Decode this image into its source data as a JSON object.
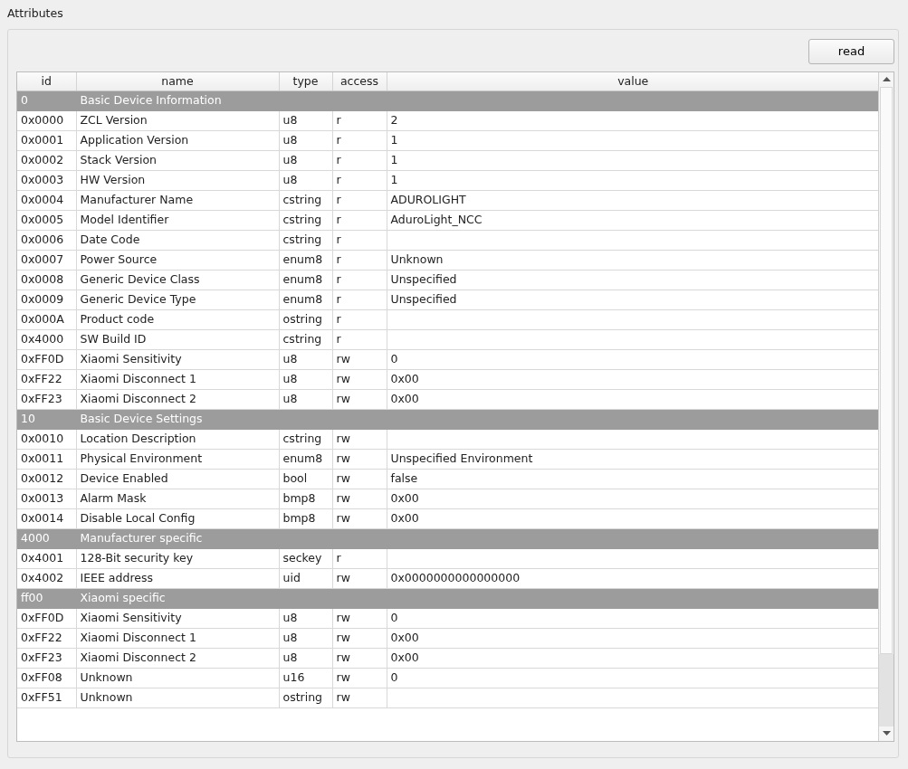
{
  "group_title": "Attributes",
  "read_button": "read",
  "table": {
    "columns": [
      "id",
      "name",
      "type",
      "access",
      "value"
    ],
    "rows": [
      {
        "kind": "group",
        "id": "0",
        "name": "Basic Device Information"
      },
      {
        "kind": "attribute",
        "id": "0x0000",
        "name": "ZCL Version",
        "type": "u8",
        "access": "r",
        "value": "2"
      },
      {
        "kind": "attribute",
        "id": "0x0001",
        "name": "Application Version",
        "type": "u8",
        "access": "r",
        "value": "1"
      },
      {
        "kind": "attribute",
        "id": "0x0002",
        "name": "Stack Version",
        "type": "u8",
        "access": "r",
        "value": "1"
      },
      {
        "kind": "attribute",
        "id": "0x0003",
        "name": "HW Version",
        "type": "u8",
        "access": "r",
        "value": "1"
      },
      {
        "kind": "attribute",
        "id": "0x0004",
        "name": "Manufacturer Name",
        "type": "cstring",
        "access": "r",
        "value": "ADUROLIGHT"
      },
      {
        "kind": "attribute",
        "id": "0x0005",
        "name": "Model Identifier",
        "type": "cstring",
        "access": "r",
        "value": "AduroLight_NCC"
      },
      {
        "kind": "attribute",
        "id": "0x0006",
        "name": "Date Code",
        "type": "cstring",
        "access": "r"
      },
      {
        "kind": "attribute",
        "id": "0x0007",
        "name": "Power Source",
        "type": "enum8",
        "access": "r",
        "value": "Unknown"
      },
      {
        "kind": "attribute",
        "id": "0x0008",
        "name": "Generic Device Class",
        "type": "enum8",
        "access": "r",
        "value": "Unspecified"
      },
      {
        "kind": "attribute",
        "id": "0x0009",
        "name": "Generic Device Type",
        "type": "enum8",
        "access": "r",
        "value": "Unspecified"
      },
      {
        "kind": "attribute",
        "id": "0x000A",
        "name": "Product code",
        "type": "ostring",
        "access": "r"
      },
      {
        "kind": "attribute",
        "id": "0x4000",
        "name": "SW Build ID",
        "type": "cstring",
        "access": "r"
      },
      {
        "kind": "attribute",
        "id": "0xFF0D",
        "name": "Xiaomi Sensitivity",
        "type": "u8",
        "access": "rw",
        "value": "0"
      },
      {
        "kind": "attribute",
        "id": "0xFF22",
        "name": "Xiaomi Disconnect 1",
        "type": "u8",
        "access": "rw",
        "value": "0x00"
      },
      {
        "kind": "attribute",
        "id": "0xFF23",
        "name": "Xiaomi Disconnect 2",
        "type": "u8",
        "access": "rw",
        "value": "0x00"
      },
      {
        "kind": "group",
        "id": "10",
        "name": "Basic Device Settings"
      },
      {
        "kind": "attribute",
        "id": "0x0010",
        "name": "Location Description",
        "type": "cstring",
        "access": "rw"
      },
      {
        "kind": "attribute",
        "id": "0x0011",
        "name": "Physical Environment",
        "type": "enum8",
        "access": "rw",
        "value": "Unspecified Environment"
      },
      {
        "kind": "attribute",
        "id": "0x0012",
        "name": "Device Enabled",
        "type": "bool",
        "access": "rw",
        "value": "false"
      },
      {
        "kind": "attribute",
        "id": "0x0013",
        "name": "Alarm Mask",
        "type": "bmp8",
        "access": "rw",
        "value": "0x00"
      },
      {
        "kind": "attribute",
        "id": "0x0014",
        "name": "Disable Local Config",
        "type": "bmp8",
        "access": "rw",
        "value": "0x00"
      },
      {
        "kind": "group",
        "id": "4000",
        "name": "Manufacturer specific"
      },
      {
        "kind": "attribute",
        "id": "0x4001",
        "name": "128-Bit security key",
        "type": "seckey",
        "access": "r"
      },
      {
        "kind": "attribute",
        "id": "0x4002",
        "name": "IEEE address",
        "type": "uid",
        "access": "rw",
        "value": "0x0000000000000000"
      },
      {
        "kind": "group",
        "id": "ff00",
        "name": "Xiaomi specific"
      },
      {
        "kind": "attribute",
        "id": "0xFF0D",
        "name": "Xiaomi Sensitivity",
        "type": "u8",
        "access": "rw",
        "value": "0"
      },
      {
        "kind": "attribute",
        "id": "0xFF22",
        "name": "Xiaomi Disconnect 1",
        "type": "u8",
        "access": "rw",
        "value": "0x00"
      },
      {
        "kind": "attribute",
        "id": "0xFF23",
        "name": "Xiaomi Disconnect 2",
        "type": "u8",
        "access": "rw",
        "value": "0x00"
      },
      {
        "kind": "attribute",
        "id": "0xFF08",
        "name": "Unknown",
        "type": "u16",
        "access": "rw",
        "value": "0"
      },
      {
        "kind": "attribute",
        "id": "0xFF51",
        "name": "Unknown",
        "type": "ostring",
        "access": "rw"
      }
    ]
  }
}
